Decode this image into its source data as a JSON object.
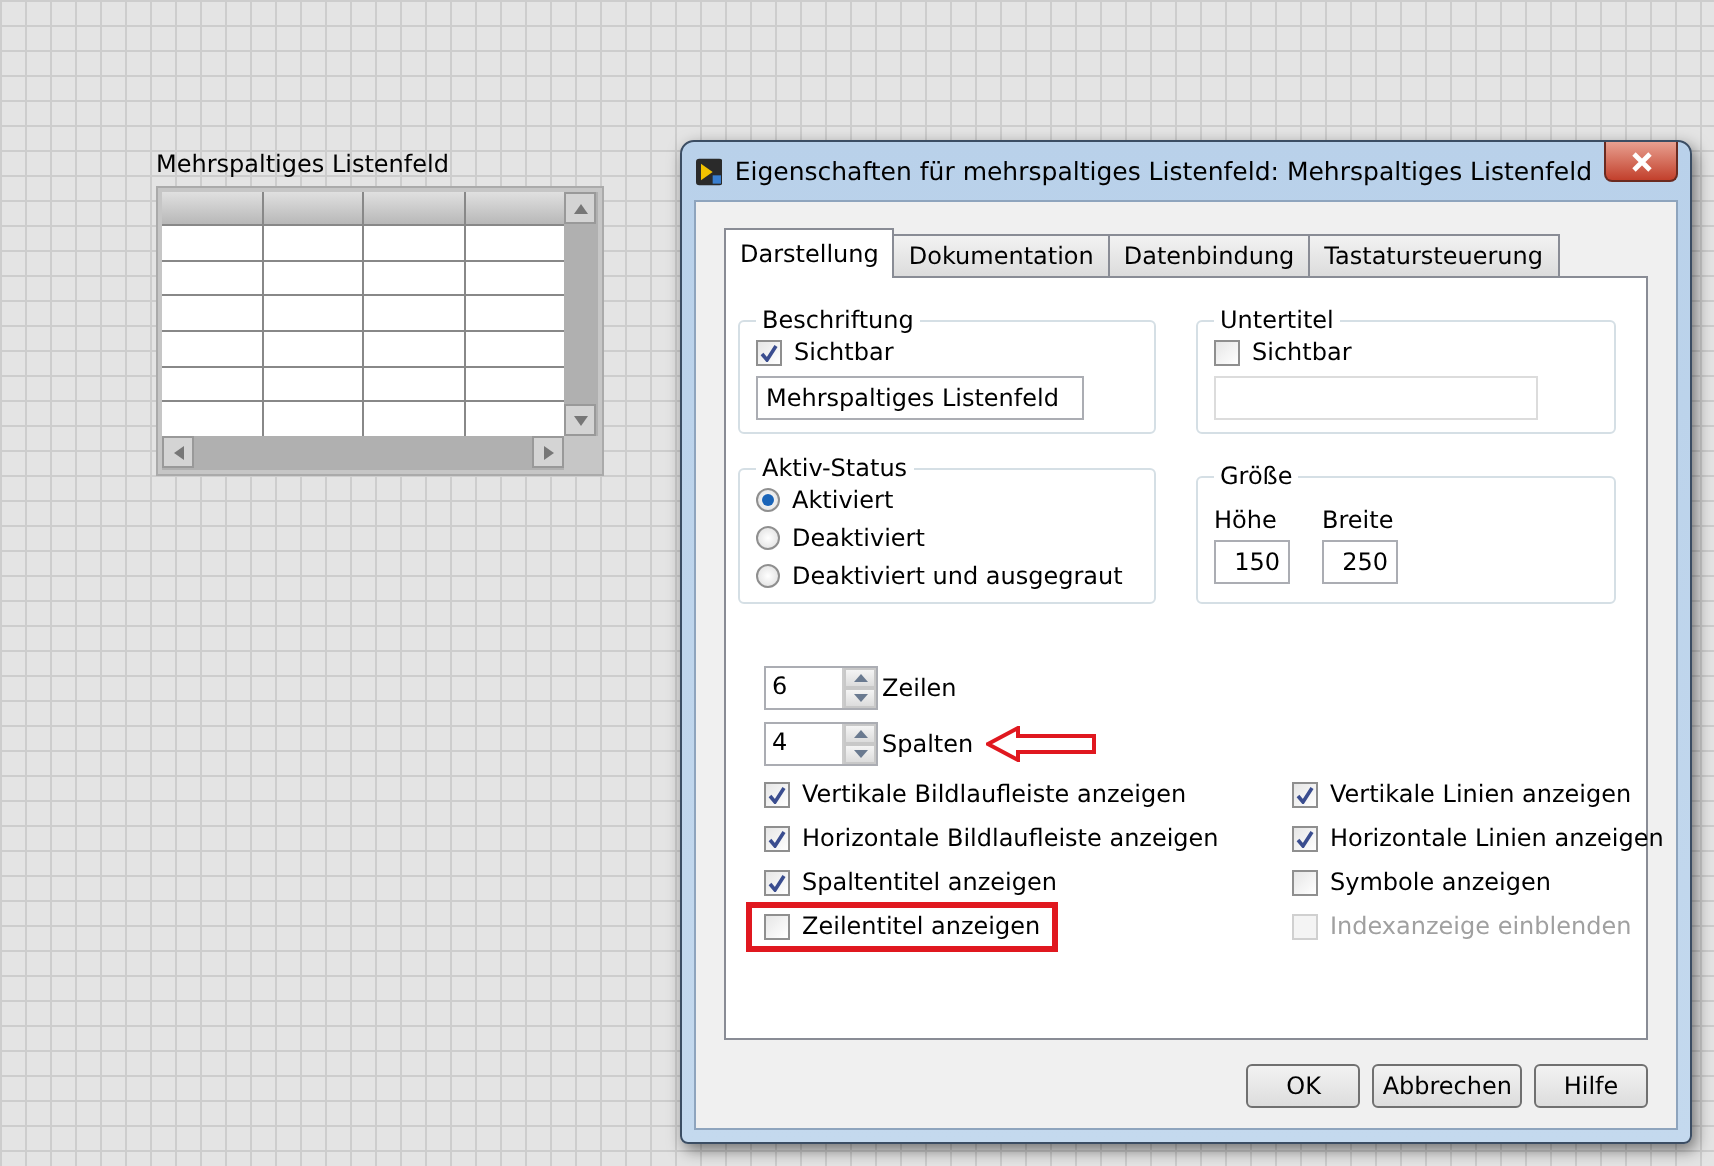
{
  "canvas": {
    "listbox": {
      "label": "Mehrspaltiges Listenfeld"
    }
  },
  "dialog": {
    "title": "Eigenschaften für mehrspaltiges Listenfeld: Mehrspaltiges Listenfeld",
    "tabs": [
      {
        "label": "Darstellung",
        "selected": true
      },
      {
        "label": "Dokumentation",
        "selected": false
      },
      {
        "label": "Datenbindung",
        "selected": false
      },
      {
        "label": "Tastatursteuerung",
        "selected": false
      }
    ],
    "label_group": {
      "title": "Beschriftung",
      "visible": {
        "label": "Sichtbar",
        "checked": true
      },
      "value": "Mehrspaltiges Listenfeld"
    },
    "caption_group": {
      "title": "Untertitel",
      "visible": {
        "label": "Sichtbar",
        "checked": false
      }
    },
    "enabled_state": {
      "title": "Aktiv-Status",
      "options": [
        {
          "label": "Aktiviert",
          "selected": true
        },
        {
          "label": "Deaktiviert",
          "selected": false
        },
        {
          "label": "Deaktiviert und ausgegraut",
          "selected": false
        }
      ]
    },
    "size": {
      "title": "Größe",
      "height": {
        "label": "Höhe",
        "value": "150"
      },
      "width": {
        "label": "Breite",
        "value": "250"
      }
    },
    "spinners": [
      {
        "value": "6",
        "label": "Zeilen",
        "arrow": false
      },
      {
        "value": "4",
        "label": "Spalten",
        "arrow": true
      }
    ],
    "options_left": [
      {
        "label": "Vertikale Bildlaufleiste anzeigen",
        "checked": true,
        "disabled": false,
        "highlighted": false
      },
      {
        "label": "Horizontale Bildlaufleiste anzeigen",
        "checked": true,
        "disabled": false,
        "highlighted": false
      },
      {
        "label": "Spaltentitel anzeigen",
        "checked": true,
        "disabled": false,
        "highlighted": false
      },
      {
        "label": "Zeilentitel anzeigen",
        "checked": false,
        "disabled": false,
        "highlighted": true
      }
    ],
    "options_right": [
      {
        "label": "Vertikale Linien anzeigen",
        "checked": true,
        "disabled": false,
        "highlighted": false
      },
      {
        "label": "Horizontale Linien anzeigen",
        "checked": true,
        "disabled": false,
        "highlighted": false
      },
      {
        "label": "Symbole anzeigen",
        "checked": false,
        "disabled": false,
        "highlighted": false
      },
      {
        "label": "Indexanzeige einblenden",
        "checked": false,
        "disabled": true,
        "highlighted": false
      }
    ],
    "buttons": [
      "OK",
      "Abbrechen",
      "Hilfe"
    ]
  }
}
